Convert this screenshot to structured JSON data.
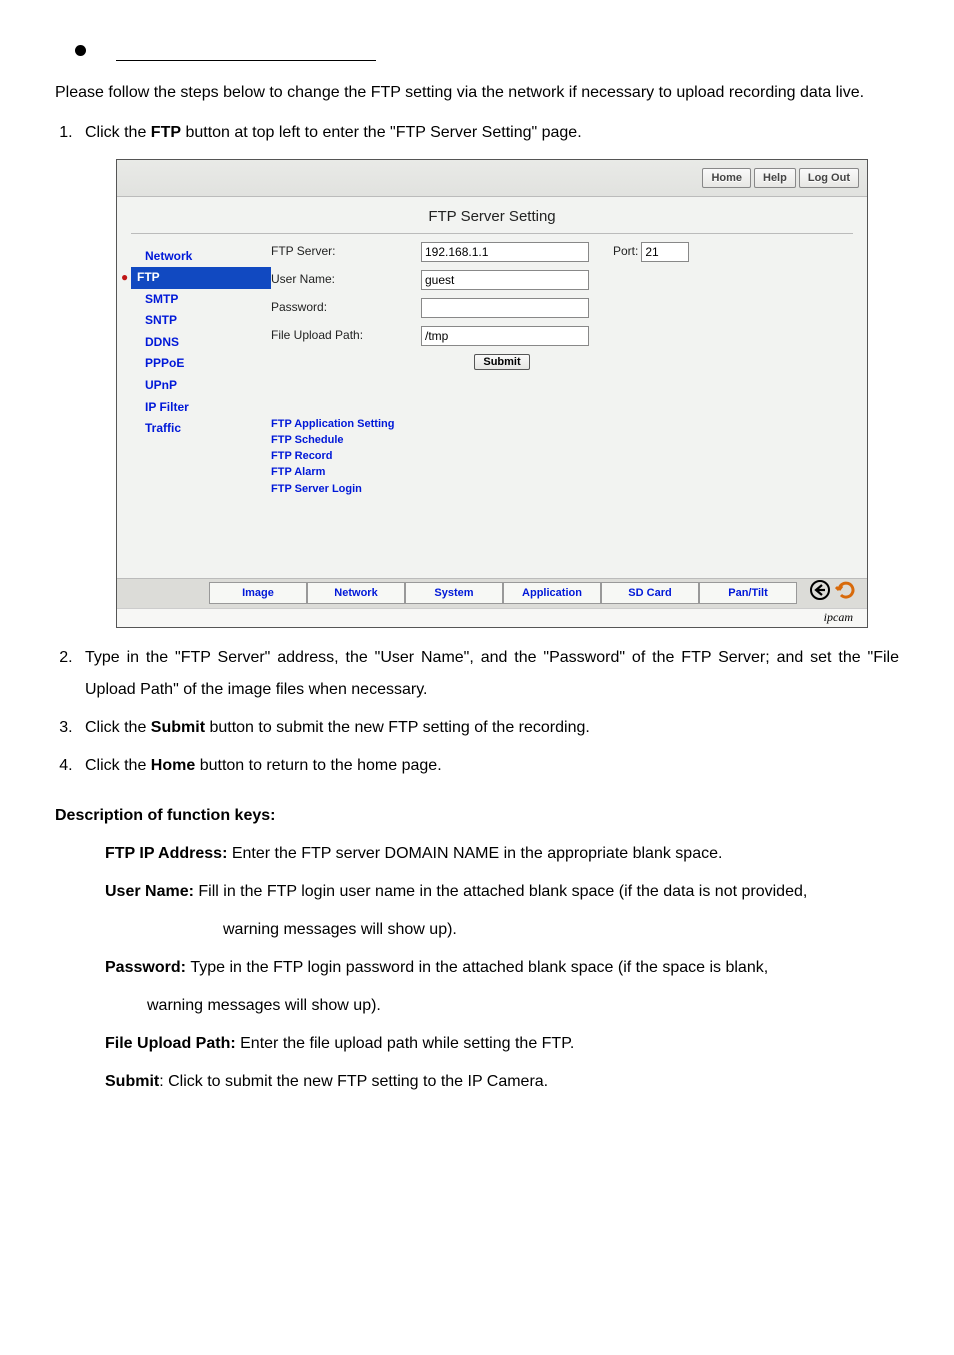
{
  "intro": "Please follow the steps below to change the FTP setting via the network if necessary to upload recording data live.",
  "steps": {
    "s1a": "Click the ",
    "s1b": "FTP",
    "s1c": " button at top left to enter the \"FTP Server Setting\" page.",
    "s2": "Type in the \"FTP Server\" address, the \"User Name\", and the \"Password\" of the FTP Server; and set the \"File Upload Path\" of the image files when necessary.",
    "s3a": "Click the ",
    "s3b": "Submit",
    "s3c": " button to submit the new FTP setting of the recording.",
    "s4a": "Click the ",
    "s4b": "Home",
    "s4c": " button to return to the home page."
  },
  "desc_heading": "Description of function keys:",
  "keys": {
    "k1_b": "FTP IP Address: ",
    "k1_t": "Enter the FTP server DOMAIN NAME in the appropriate blank space.",
    "k2_b": "User Name: ",
    "k2_t": "Fill in the FTP login user name in the attached blank space (if the data is not provided,",
    "k2_t2": "warning messages will show up).",
    "k3_b": "Password: ",
    "k3_t": "Type in the FTP login password in the attached blank space (if the space is blank,",
    "k3_t2": "warning messages will show up).",
    "k4_b": "File Upload Path: ",
    "k4_t": "Enter the file upload path while setting the FTP.",
    "k5_b": "Submit",
    "k5_t": ": Click to submit the new FTP setting to the IP Camera."
  },
  "ui": {
    "topbtn": {
      "home": "Home",
      "help": "Help",
      "logout": "Log Out"
    },
    "title": "FTP Server Setting",
    "side": {
      "network": "Network",
      "ftp": "FTP",
      "smtp": "SMTP",
      "sntp": "SNTP",
      "ddns": "DDNS",
      "pppoe": "PPPoE",
      "upnp": "UPnP",
      "ipfilter": "IP Filter",
      "traffic": "Traffic"
    },
    "form": {
      "ftpserver_l": "FTP Server:",
      "ftpserver_v": "192.168.1.1",
      "port_l": "Port:",
      "port_v": "21",
      "username_l": "User Name:",
      "username_v": "guest",
      "password_l": "Password:",
      "password_v": "",
      "upload_l": "File Upload Path:",
      "upload_v": "/tmp",
      "submit": "Submit"
    },
    "links": {
      "l1": "FTP Application Setting",
      "l2": "FTP Schedule",
      "l3": "FTP Record",
      "l4": "FTP Alarm",
      "l5": "FTP Server Login"
    },
    "tabs": {
      "t1": "Image",
      "t2": "Network",
      "t3": "System",
      "t4": "Application",
      "t5": "SD Card",
      "t6": "Pan/Tilt"
    },
    "brand": "ipcam"
  }
}
